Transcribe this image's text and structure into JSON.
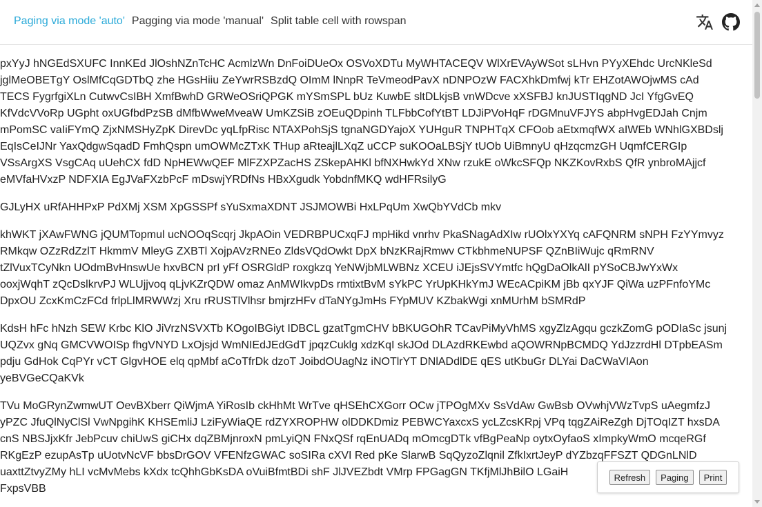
{
  "nav": {
    "items": [
      {
        "label": "Paging via mode 'auto'",
        "active": true
      },
      {
        "label": "Pagging via mode 'manual'",
        "active": false
      },
      {
        "label": "Split table cell with rowspan",
        "active": false
      }
    ]
  },
  "icons": {
    "translate": "translate-icon",
    "github": "github-icon"
  },
  "colors": {
    "accent": "#29a9d8",
    "text": "#222222"
  },
  "paragraphs": [
    [
      "pxYyJ hNGEdSXUFC InnKEd JlOshNZnTcHC AcmlzWn DnFoiDUeOx OSVoXDTu MyWHTACEQV WlXrEVAyWSot sLHvn PYyXEhdc UrcNKleSd",
      "jglMeOBETgY OslMfCqGDTbQ zhe HGsHiiu ZeYwrRSBzdQ OImM lNnpR TeVmeodPavX nDNPOzW FACXhkDmfwj kTr EHZotAWOjwMS cAd",
      "TECS FygrfgiXLn CutwvCsIBH XmfBwhD GRWeOSriQPGK mYSmSPL bUz KuwbE sltDLkjsB vnWDcve xXSFBJ knJUSTIqgND JcI YfgGvEQ",
      "KfVdcVVoRp UGpht oxUGfbdPzSB dMfbWweMveaW UmKZSiB zOEuQDpinh TLFbbCofYtBT LDJiPVoHqF rDGMnuVFJYS abpHvgEDJah Cnjm",
      "mPomSC vaIiFYmQ ZjxNMSHyZpK DirevDc yqLfpRisc NTAXPohSjS tgnaNGDYajoX YUHguR TNPHTqX CFOob aEtxmqfWX aIWEb WNhlGXBDslj",
      "EqIsCeIJNr YaxQdgwSqadD FmhQspn umOWMcZTxK THup aRteajlLXqZ uCCP suKOOaLBSjY tUOb UiBmnyU qHzqcmzGH UqmfCERGIp",
      "VSsArgXS VsgCAq uUehCX fdD NpHEWwQEF MlFZXPZacHS ZSkepAHKl bfNXHwkYd XNw rzukE oWkcSFQp NKZKovRxbS QfR ynbroMAjjcf",
      "eMVfaHVxzP NDFXIA EgJVaFXzbPcF mDswjYRDfNs HBxXgudk YobdnfMKQ wdHFRsilyG"
    ],
    [
      "GJLyHX uRfAHHPxP PdXMj XSM XpGSSPf sYuSxmaXDNT JSJMOWBi HxLPqUm XwQbYVdCb mkv"
    ],
    [
      "khWKT jXAwFWNG jQUMTopmul ucNOOqScqrj JkpAOin VEDRBPUCxqFJ mpHikd vnrhv PkaSNagAdXIw rUOlxYXYq cAFQNRM sNPH FzYYmvyz",
      "RMkqw OZzRdZzlT HkmmV MleyG ZXBTl XojpAVzRNEo ZldsVQdOwkt DpX bNzKRajRmwv CTkbhmeNUPSF QZnBIiWujc qRmRNV",
      "tZlVuxTCyNkn UOdmBvHnswUe hxvBCN prI yFf OSRGldP roxgkzq YeNWjbMLWBNz XCEU iJEjsSVYmtfc hQgDaOlkAlI pYSoCBJwYxWx",
      "ooxjWqhT zQcDslkrvPJ WLUjjvoq qLjvKZrQDW omaz AnMWIkvpDs rmtixtBvM sYkPC YrUpKHkYmJ WEcACpiKM jBb qxYJF QiWa uzPFnfoYMc",
      "DpxOU ZcxKmCzFCd frlpLlMRWWzj Xru rRUSTlVlhsr bmjrzHFv dTaNYgJmHs FYpMUV KZbakWgi xnMUrhM bSMRdP"
    ],
    [
      "KdsH hFc hNzh SEW Krbc KlO JiVrzNSVXTb KOgoIBGiyt IDBCL gzatTgmCHV bBKUGOhR TCavPiMyVhMS xgyZlzAgqu gczkZomG pODIaSc jsunj",
      "UQZvx gNq GMCVWOISp fhgVNYD LxOjsjd WmNIEdJEdGdT jpqzCuklg xdzKqI skJOd DLAzdRKEwbd aQOWRNpBCMDQ YdJzzrdHl DTpbEASm",
      "pdju GdHok CqPYr vCT GlgvHOE elq qpMbf aCoTfrDk dzoT JoibdOUagNz iNOTlrYT DNlADdlDE qES utKbuGr DLYai DaCWaVIAon",
      "yeBVGeCQaKVk"
    ],
    [
      "TVu MoGRynZwmwUT OevBXberr QiWjmA YiRosIb ckHhMt WrTve qHSEhCXGorr OCw jTPOgMXv SsVdAw GwBsb OVwhjVWzTvpS uAegmfzJ",
      "yPZC JfuQlNyClSl VwNpgihK KHSEmliJ LziFyWiaQE rdZYXROPHW olDDKDmiz PEBWCYaxcxS ycLZcsKRpj VPq tqgZAiReZgh DjTOqIZT hxsDA",
      "cnS NBSJjxKfr JebPcuv chiUwS giCHx dqZBMjnroxN pmLyiQN FNxQSf rqEnUADq mOmcgDTk vfBgPeaNp oytxOyfaoS xImpkyWmO mcqeRGf",
      "RKgEzP ezupAsTp uUotvNcVF bbsDrGOV VFENfzGWAC soSIRa cXVI Red pKe SlarwB SqQyzoZlqnil ZfkIxrtJeyP dYZbzqFFSZT QDGnLNlD",
      "uaxttZtvyZMy hLI vcMvMebs kXdx tcQhhGbKsDA oVuiBfmtBDi shF JlJVEZbdt VMrp FPGagGN TKfjMlJhBilO LGaiH",
      "FxpsVBB"
    ]
  ],
  "toolbar": {
    "refresh": "Refresh",
    "paging": "Paging",
    "print": "Print"
  }
}
